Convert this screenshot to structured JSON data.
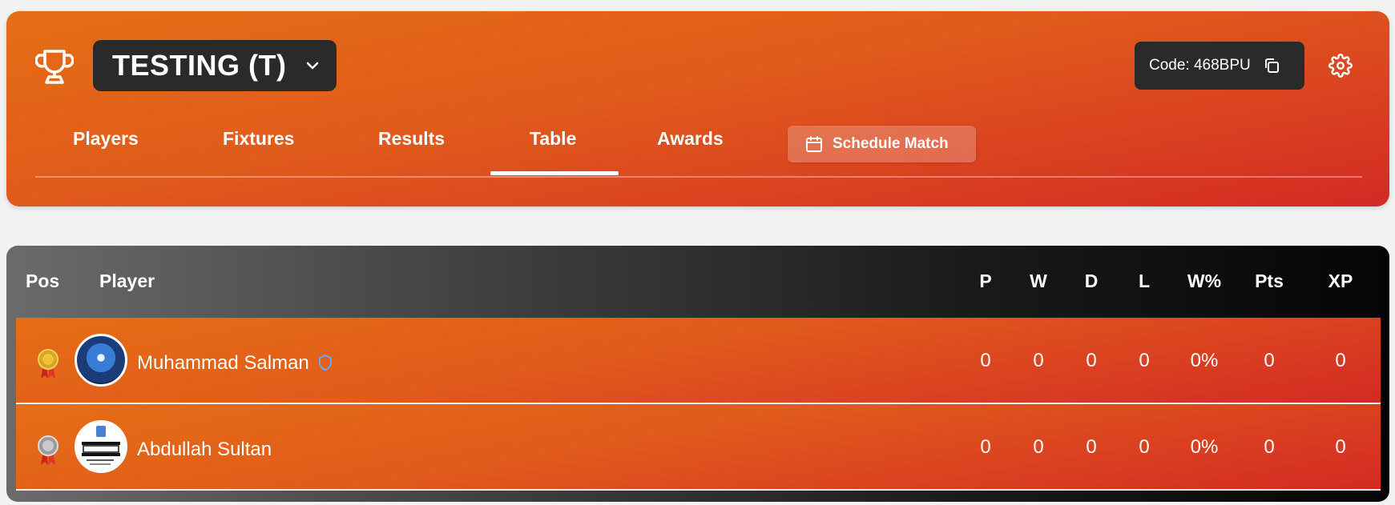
{
  "header": {
    "league_name": "TESTING (T)",
    "code_label": "Code: 468BPU"
  },
  "tabs": [
    {
      "label": "Players",
      "active": false
    },
    {
      "label": "Fixtures",
      "active": false
    },
    {
      "label": "Results",
      "active": false
    },
    {
      "label": "Table",
      "active": true
    },
    {
      "label": "Awards",
      "active": false
    }
  ],
  "schedule_button": {
    "label": "Schedule Match"
  },
  "table": {
    "columns": [
      "Pos",
      "Player",
      "P",
      "W",
      "D",
      "L",
      "W%",
      "Pts",
      "XP"
    ],
    "rows": [
      {
        "medal": "gold-medal",
        "name": "Muhammad Salman",
        "admin_badge": "shield-icon",
        "p": "0",
        "w": "0",
        "d": "0",
        "l": "0",
        "wpct": "0%",
        "pts": "0",
        "xp": "0"
      },
      {
        "medal": "silver-medal",
        "name": "Abdullah Sultan",
        "p": "0",
        "w": "0",
        "d": "0",
        "l": "0",
        "wpct": "0%",
        "pts": "0",
        "xp": "0"
      }
    ]
  },
  "colors": {
    "header_gradient_start": "#e66e15",
    "header_gradient_end": "#d42a24",
    "dark_box": "#2a2a2a"
  }
}
